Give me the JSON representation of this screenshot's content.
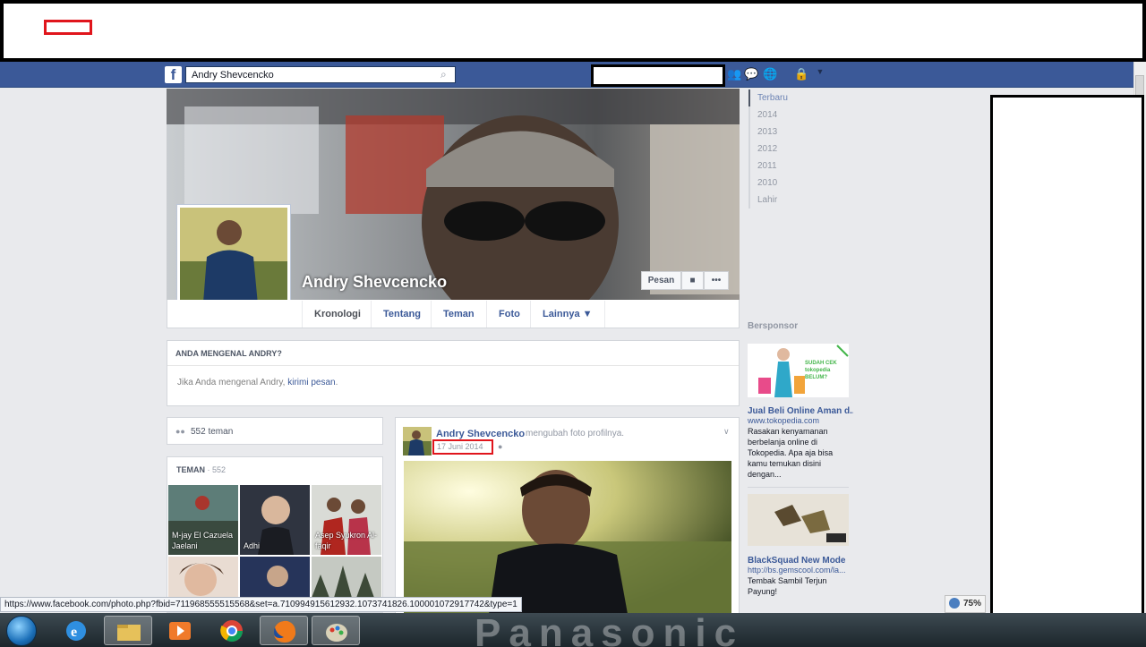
{
  "browser": {
    "status_url": "https://www.facebook.com/photo.php?fbid=711968555515568&set=a.710994915612932.1073741826.100001072917742&type=1",
    "zoom": "75%"
  },
  "topbar": {
    "logo": "f",
    "search_value": "Andry Shevcencko"
  },
  "profile": {
    "name": "Andry Shevcencko",
    "message_button": "Pesan",
    "more_button": "•••",
    "tabs": [
      {
        "label": "Kronologi"
      },
      {
        "label": "Tentang"
      },
      {
        "label": "Teman"
      },
      {
        "label": "Foto"
      },
      {
        "label": "Lainnya ▼"
      }
    ]
  },
  "know_box": {
    "title": "ANDA MENGENAL ANDRY?",
    "text": "Jika Anda mengenal Andry, ",
    "link": "kirimi pesan",
    "suffix": "."
  },
  "friends": {
    "count_text": "552 teman",
    "panel_title": "TEMAN",
    "panel_count": " · 552",
    "items": [
      {
        "name": "M-jay El Cazuela Jaelani"
      },
      {
        "name": "Adhi"
      },
      {
        "name": "Asep Syukron Al-faqir"
      },
      {
        "name": ""
      },
      {
        "name": ""
      },
      {
        "name": ""
      }
    ]
  },
  "post": {
    "author": "Andry Shevcencko",
    "action": "mengubah foto profilnya.",
    "date": "17 Juni 2014"
  },
  "timeline_years": [
    "Terbaru",
    "2014",
    "2013",
    "2012",
    "2011",
    "2010",
    "Lahir"
  ],
  "sponsored": {
    "title": "Bersponsor",
    "ads": [
      {
        "image_text": "SUDAH CEK tokopedia BELUM?",
        "title": "Jual Beli Online Aman d...",
        "url": "www.tokopedia.com",
        "body": "Rasakan kenyamanan berbelanja online di Tokopedia. Apa aja bisa kamu temukan disini dengan..."
      },
      {
        "title": "BlackSquad New Mode",
        "url": "http://bs.gemscool.com/la...",
        "body": "Tembak Sambil Terjun Payung!"
      }
    ]
  },
  "taskbar": {
    "background_text": "Panasonic"
  }
}
